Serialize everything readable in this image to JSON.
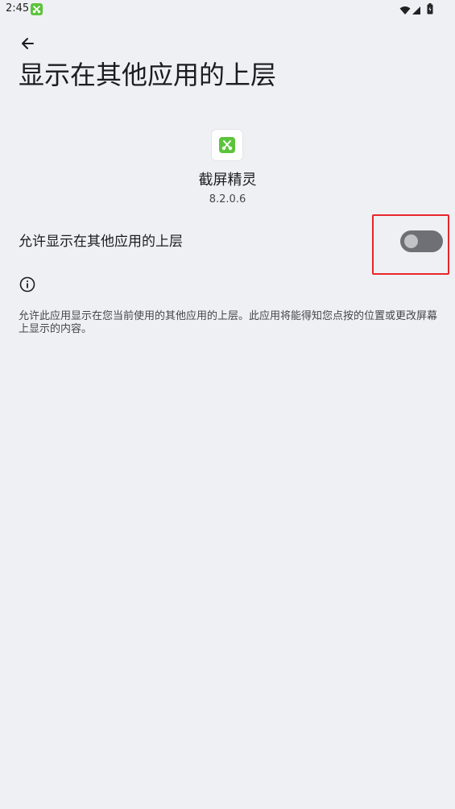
{
  "status_bar": {
    "time": "2:45"
  },
  "header": {
    "title": "显示在其他应用的上层"
  },
  "app": {
    "name": "截屏精灵",
    "version": "8.2.0.6",
    "icon_color": "#5cc43c"
  },
  "permission": {
    "label": "允许显示在其他应用的上层",
    "enabled": false,
    "info_text": "允许此应用显示在您当前使用的其他应用的上层。此应用将能得知您点按的位置或更改屏幕上显示的内容。"
  },
  "colors": {
    "background": "#eff0f3",
    "highlight": "#e8262a",
    "toggle_track_off": "#6e7075"
  }
}
